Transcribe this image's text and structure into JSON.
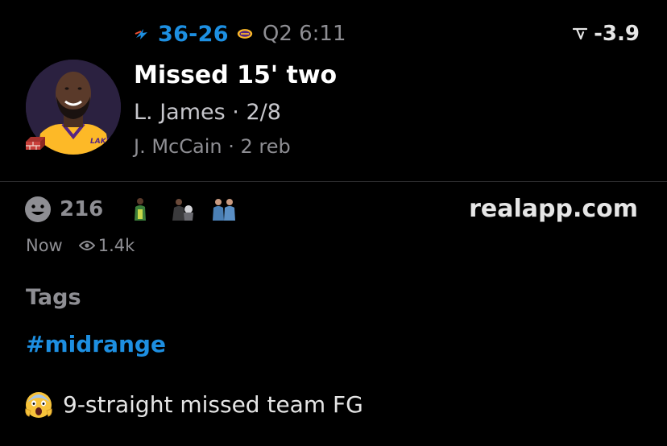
{
  "game": {
    "away_logo": "thunder-logo-icon",
    "home_logo": "lakers-logo-icon",
    "score": "36-26",
    "quarter_clock": "Q2 6:11"
  },
  "odds": {
    "icon": "trend-down-icon",
    "value": "-3.9"
  },
  "play": {
    "avatar": "player-avatar",
    "badge_icon": "brick-icon",
    "title": "Missed 15' two",
    "player_line": "L. James · 2/8",
    "secondary_line": "J. McCain · 2 reb"
  },
  "reactions": {
    "icon": "smile-icon",
    "count": "216",
    "reactor_avatars": [
      "reactor-avatar-1",
      "reactor-avatar-2",
      "reactor-avatar-3"
    ]
  },
  "site": "realapp.com",
  "meta": {
    "time": "Now",
    "views": "1.4k"
  },
  "tags": {
    "heading": "Tags",
    "items": [
      "#midrange"
    ]
  },
  "note": {
    "icon": "screaming-face-icon",
    "text": "9-straight missed team FG"
  },
  "colors": {
    "background": "#000000",
    "accent_blue": "#1d8fe1",
    "muted_gray": "#8e8e93",
    "lakers_gold": "#fdb927",
    "lakers_purple": "#552583",
    "brick_red": "#c9413b"
  }
}
